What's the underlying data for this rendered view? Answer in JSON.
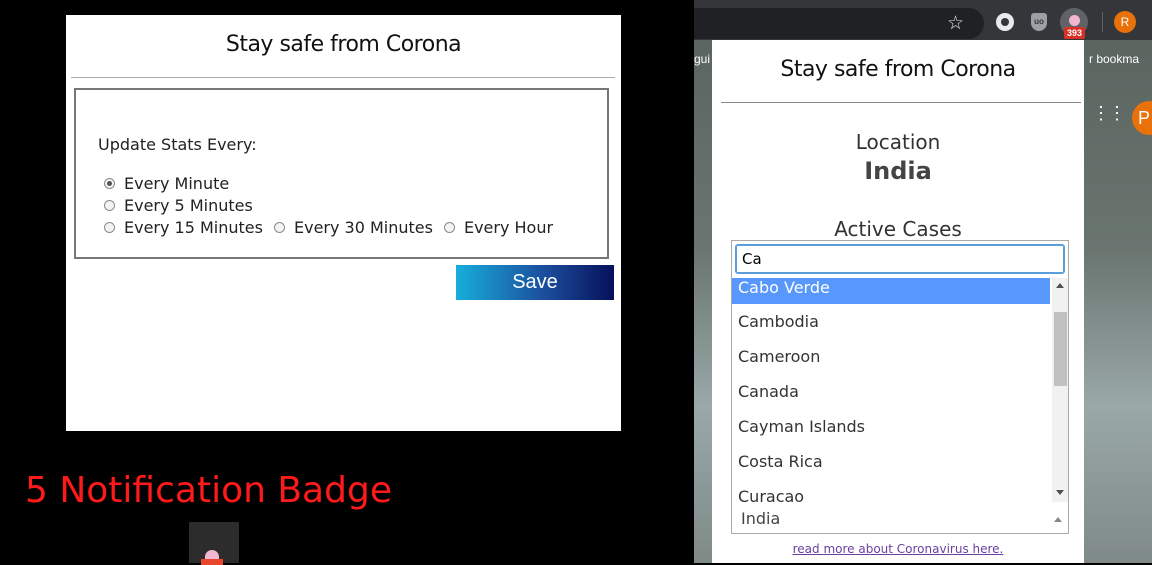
{
  "options_page": {
    "title": "Stay safe from Corona",
    "update_label": "Update Stats Every:",
    "intervals": [
      {
        "label": "Every Minute",
        "checked": true
      },
      {
        "label": "Every 5 Minutes",
        "checked": false
      },
      {
        "label": "Every 15 Minutes",
        "checked": false
      },
      {
        "label": "Every 30 Minutes",
        "checked": false
      },
      {
        "label": "Every Hour",
        "checked": false
      }
    ],
    "save_label": "Save"
  },
  "badge_section": {
    "caption": "5 Notification Badge"
  },
  "browser": {
    "bookmark_left": "gui",
    "bookmark_right": "r bookma",
    "profile_initial": "R",
    "google_avatar_initial": "P",
    "extension_badge": "393",
    "icons": [
      "star-icon",
      "extension-icon",
      "ublock-icon",
      "corona-extension-icon",
      "apps-grid-icon"
    ]
  },
  "popup": {
    "title": "Stay safe from Corona",
    "location_label": "Location",
    "location_value": "India",
    "active_label": "Active Cases",
    "search_value": "Ca",
    "options": [
      "Cabo Verde",
      "Cambodia",
      "Cameroon",
      "Canada",
      "Cayman Islands",
      "Costa Rica",
      "Curacao"
    ],
    "highlighted_option": "Cabo Verde",
    "selected_value": "India",
    "read_more": "read more about Coronavirus here."
  },
  "colors": {
    "save_gradient_start": "#18aedb",
    "save_gradient_end": "#07105a",
    "caption_red": "#ff1a1a",
    "highlight_blue": "#5897fb"
  }
}
